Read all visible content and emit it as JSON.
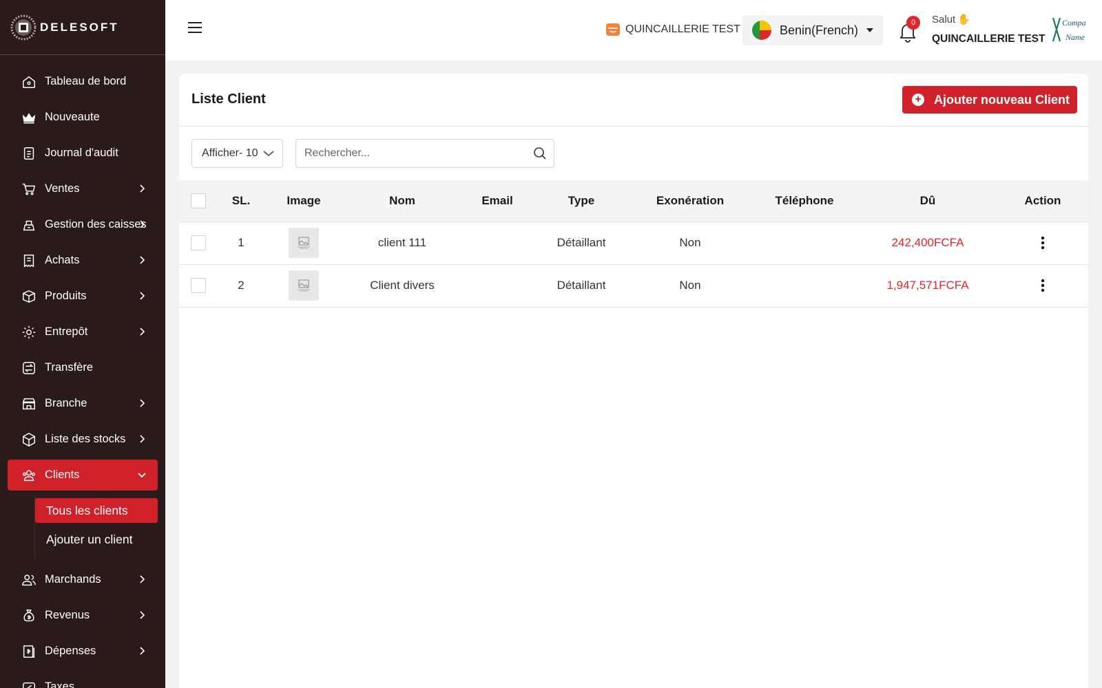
{
  "brand": {
    "name": "DELESOFT"
  },
  "sidebar": {
    "items": [
      {
        "label": "Tableau de bord",
        "icon": "home-icon",
        "has_children": false
      },
      {
        "label": "Nouveaute",
        "icon": "crown-icon",
        "has_children": false
      },
      {
        "label": "Journal d'audit",
        "icon": "clipboard-icon",
        "has_children": false
      },
      {
        "label": "Ventes",
        "icon": "cart-icon",
        "has_children": true
      },
      {
        "label": "Gestion des caisses",
        "icon": "cash-register-icon",
        "has_children": true
      },
      {
        "label": "Achats",
        "icon": "receipt-icon",
        "has_children": true
      },
      {
        "label": "Produits",
        "icon": "box-icon",
        "has_children": true
      },
      {
        "label": "Entrepôt",
        "icon": "warehouse-gear-icon",
        "has_children": true
      },
      {
        "label": "Transfère",
        "icon": "transfer-icon",
        "has_children": false
      },
      {
        "label": "Branche",
        "icon": "store-icon",
        "has_children": true
      },
      {
        "label": "Liste des stocks",
        "icon": "cube-icon",
        "has_children": true
      },
      {
        "label": "Clients",
        "icon": "users-icon",
        "has_children": true,
        "active": true,
        "expanded": true
      },
      {
        "label": "Marchands",
        "icon": "user-group-icon",
        "has_children": true
      },
      {
        "label": "Revenus",
        "icon": "money-bag-icon",
        "has_children": true
      },
      {
        "label": "Dépenses",
        "icon": "expense-receipt-icon",
        "has_children": true
      },
      {
        "label": "Taxes",
        "icon": "tax-icon",
        "has_children": false
      }
    ],
    "clients_submenu": [
      {
        "label": "Tous les clients",
        "active": true
      },
      {
        "label": "Ajouter un client",
        "active": false
      }
    ]
  },
  "header": {
    "store_name": "QUINCAILLERIE TEST",
    "language": "Benin(French)",
    "notification_count": "0",
    "greeting": "Salut",
    "greeting_emoji": "✋",
    "user_name": "QUINCAILLERIE TEST",
    "company_logo_text": "Company Name"
  },
  "page": {
    "title": "Liste Client",
    "add_button_label": "Ajouter nouveau Client",
    "show_select_label": "Afficher- 10",
    "search_placeholder": "Rechercher..."
  },
  "table": {
    "columns": [
      "SL.",
      "Image",
      "Nom",
      "Email",
      "Type",
      "Exonération",
      "Téléphone",
      "Dû",
      "Action"
    ],
    "rows": [
      {
        "sl": "1",
        "name": "client 111",
        "email": "",
        "type": "Détaillant",
        "exoneration": "Non",
        "phone": "",
        "due": "242,400FCFA"
      },
      {
        "sl": "2",
        "name": "Client divers",
        "email": "",
        "type": "Détaillant",
        "exoneration": "Non",
        "phone": "",
        "due": "1,947,571FCFA"
      }
    ]
  },
  "colors": {
    "sidebar_bg": "#2a1a1a",
    "accent_red": "#d0202a",
    "due_red": "#e0262d"
  }
}
